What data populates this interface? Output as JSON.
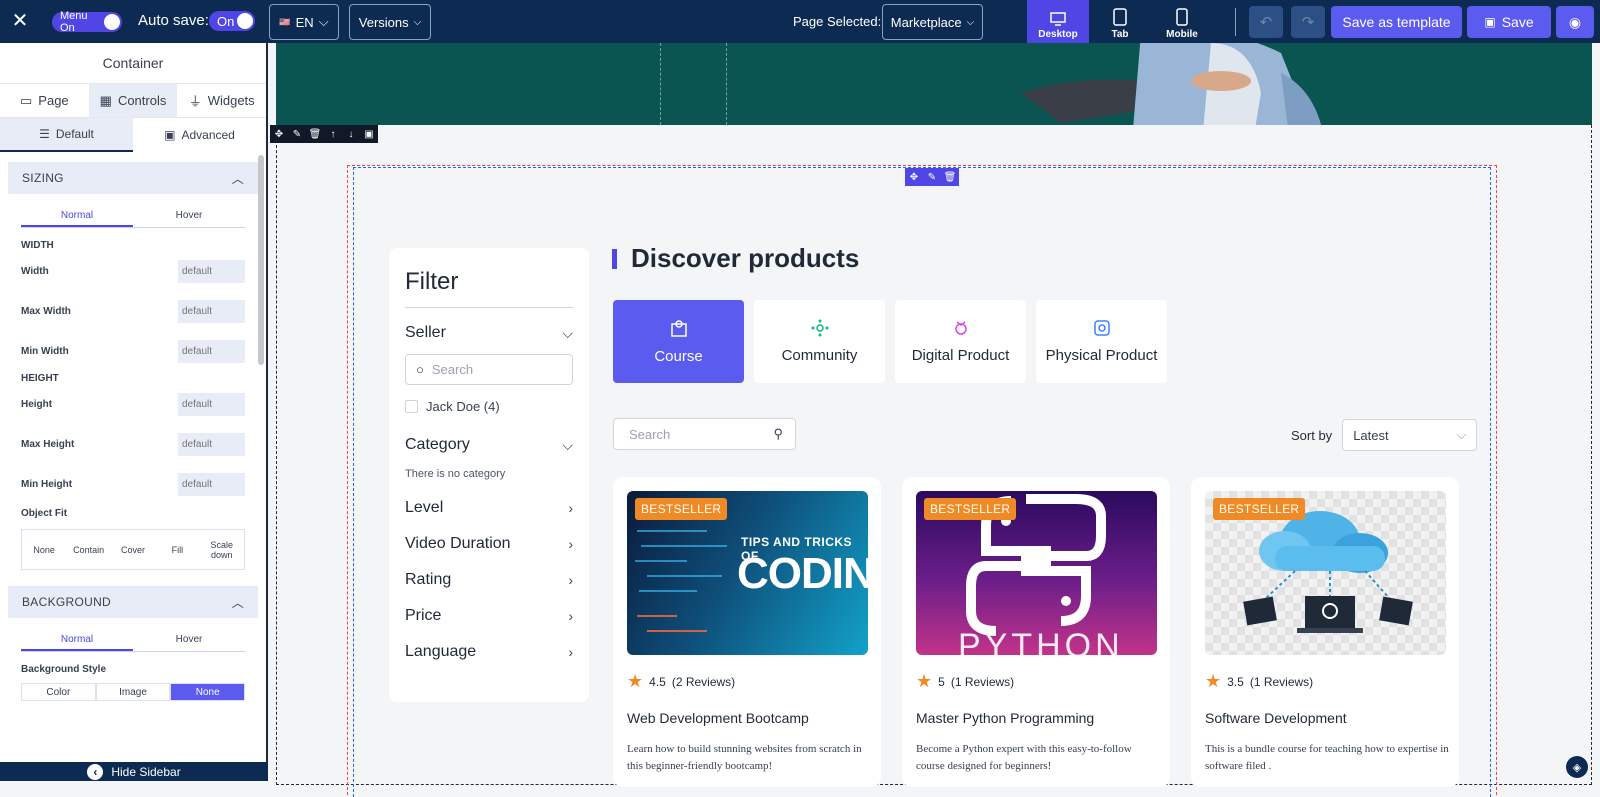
{
  "topbar": {
    "menu_toggle": "Menu On",
    "autosave_label": "Auto save:",
    "autosave_toggle": "On",
    "language": "EN",
    "versions": "Versions",
    "page_selected_label": "Page Selected:",
    "page_selected_value": "Marketplace",
    "devices": [
      "Desktop",
      "Tab",
      "Mobile"
    ],
    "save_template": "Save as template",
    "save": "Save"
  },
  "sidebar": {
    "title": "Container",
    "tabs": [
      "Page",
      "Controls",
      "Widgets"
    ],
    "subtabs": [
      "Default",
      "Advanced"
    ],
    "sizing": {
      "header": "SIZING",
      "modes": [
        "Normal",
        "Hover"
      ],
      "width_group": "WIDTH",
      "height_group": "HEIGHT",
      "fields": [
        {
          "label": "Width",
          "placeholder": "default"
        },
        {
          "label": "Max Width",
          "placeholder": "default"
        },
        {
          "label": "Min Width",
          "placeholder": "default"
        },
        {
          "label": "Height",
          "placeholder": "default"
        },
        {
          "label": "Max Height",
          "placeholder": "default"
        },
        {
          "label": "Min Height",
          "placeholder": "default"
        }
      ],
      "object_fit_label": "Object Fit",
      "object_fit_options": [
        "None",
        "Contain",
        "Cover",
        "Fill",
        "Scale down"
      ]
    },
    "background": {
      "header": "BACKGROUND",
      "modes": [
        "Normal",
        "Hover"
      ],
      "style_label": "Background Style",
      "style_options": [
        "Color",
        "Image",
        "None"
      ]
    },
    "hide_sidebar": "Hide Sidebar"
  },
  "filter": {
    "title": "Filter",
    "seller_label": "Seller",
    "search_placeholder": "Search",
    "seller_option": "Jack Doe (4)",
    "category_label": "Category",
    "category_empty": "There is no category",
    "sections": [
      "Level",
      "Video Duration",
      "Rating",
      "Price",
      "Language"
    ]
  },
  "main": {
    "title": "Discover products",
    "types": [
      "Course",
      "Community",
      "Digital Product",
      "Physical Product"
    ],
    "search_placeholder": "Search",
    "sort_label": "Sort by",
    "sort_value": "Latest"
  },
  "products": [
    {
      "badge": "BESTSELLER",
      "rating": "4.5",
      "reviews": "(2 Reviews)",
      "name": "Web Development Bootcamp",
      "description": "Learn how to build stunning websites from scratch in this beginner-friendly bootcamp!",
      "thumb_text_1": "TIPS AND TRICKS OF",
      "thumb_text_2": "CODING"
    },
    {
      "badge": "BESTSELLER",
      "rating": "5",
      "reviews": "(1 Reviews)",
      "name": "Master Python Programming",
      "description": "Become a Python expert with this easy-to-follow course designed for beginners!",
      "thumb_text_1": "PYTHON"
    },
    {
      "badge": "BESTSELLER",
      "rating": "3.5",
      "reviews": "(1 Reviews)",
      "name": "Software Development",
      "description": "This is a bundle course for teaching how to expertise in software filed ."
    }
  ],
  "colors": {
    "topbar": "#0d2b52",
    "accent": "#5b5bf0",
    "badge": "#f08a24",
    "hero": "#0a5552"
  }
}
